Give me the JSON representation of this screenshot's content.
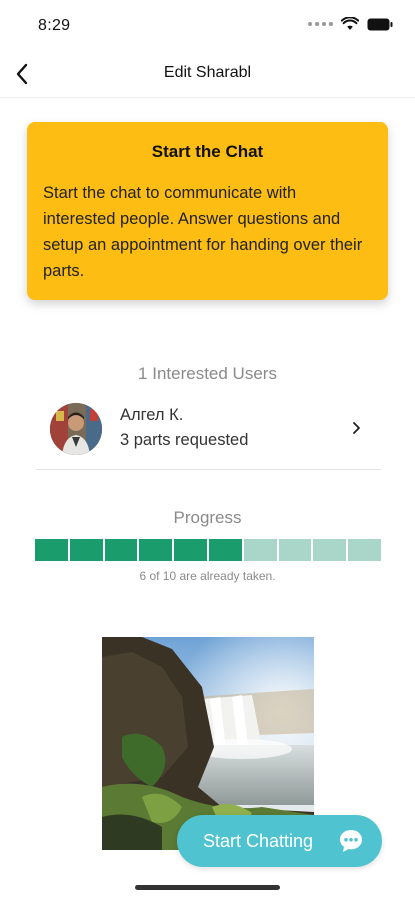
{
  "status_bar": {
    "time": "8:29"
  },
  "nav": {
    "title": "Edit Sharabl"
  },
  "info_card": {
    "title": "Start the Chat",
    "body": "Start the chat to communicate with interested people. Answer questions and setup an appointment for handing over their parts."
  },
  "interested": {
    "header": "1 Interested Users",
    "users": [
      {
        "name": "Алгел К.",
        "parts": "3 parts requested"
      }
    ]
  },
  "progress": {
    "label": "Progress",
    "taken": 6,
    "total": 10,
    "caption": "6 of 10 are already taken.",
    "filled_color": "#1a9c6c",
    "empty_color": "#a9d6c8"
  },
  "chat_button": {
    "label": "Start Chatting"
  },
  "colors": {
    "accent": "#fdbd13",
    "chat": "#4fc3cf"
  }
}
